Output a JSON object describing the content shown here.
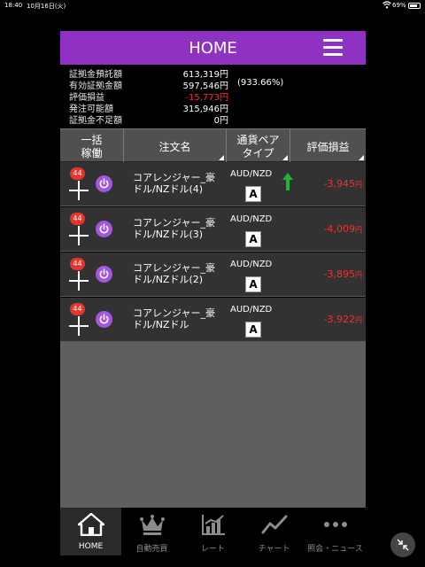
{
  "status_bar": {
    "time": "18:40",
    "date": "10月16日(火)",
    "battery": "69%"
  },
  "header": {
    "title": "HOME"
  },
  "summary": [
    {
      "label": "証拠金預託額",
      "value": "613,319円",
      "extra": ""
    },
    {
      "label": "有効証拠金額",
      "value": "597,546円",
      "extra": "(933.66%)"
    },
    {
      "label": "評価損益",
      "value": "-15,773円",
      "extra": ""
    },
    {
      "label": "発注可能額",
      "value": "315,946円",
      "extra": ""
    },
    {
      "label": "証拠金不足額",
      "value": "0円",
      "extra": ""
    }
  ],
  "table": {
    "headers": {
      "bulk_line1": "一括",
      "bulk_line2": "稼働",
      "order_name": "注文名",
      "pair_line1": "通貨ペア",
      "pair_line2": "タイプ",
      "pl": "評価損益"
    },
    "rows": [
      {
        "badge": "44",
        "name_line1": "コアレンジャー_豪",
        "name_line2": "ドル/NZドル(4)",
        "pair": "AUD/NZD",
        "type": "A",
        "pl_value": "-3,945",
        "pl_unit": "円",
        "trend": "up"
      },
      {
        "badge": "44",
        "name_line1": "コアレンジャー_豪",
        "name_line2": "ドル/NZドル(3)",
        "pair": "AUD/NZD",
        "type": "A",
        "pl_value": "-4,009",
        "pl_unit": "円",
        "trend": ""
      },
      {
        "badge": "44",
        "name_line1": "コアレンジャー_豪",
        "name_line2": "ドル/NZドル(2)",
        "pair": "AUD/NZD",
        "type": "A",
        "pl_value": "-3,895",
        "pl_unit": "円",
        "trend": ""
      },
      {
        "badge": "44",
        "name_line1": "コアレンジャー_豪",
        "name_line2": "ドル/NZドル",
        "pair": "AUD/NZD",
        "type": "A",
        "pl_value": "-3,922",
        "pl_unit": "円",
        "trend": ""
      }
    ]
  },
  "tabs": [
    {
      "label": "HOME",
      "icon": "home-icon",
      "active": true
    },
    {
      "label": "自動売買",
      "icon": "crown-icon",
      "active": false
    },
    {
      "label": "レート",
      "icon": "rate-chart-icon",
      "active": false
    },
    {
      "label": "チャート",
      "icon": "line-chart-icon",
      "active": false
    },
    {
      "label": "照会・ニュース",
      "icon": "more-dots-icon",
      "active": false
    }
  ],
  "colors": {
    "header": "#8f32c3",
    "negative": "#ff2b2b",
    "badge": "#e5362e",
    "power": "#a257dc",
    "trend_up": "#22b33a"
  }
}
